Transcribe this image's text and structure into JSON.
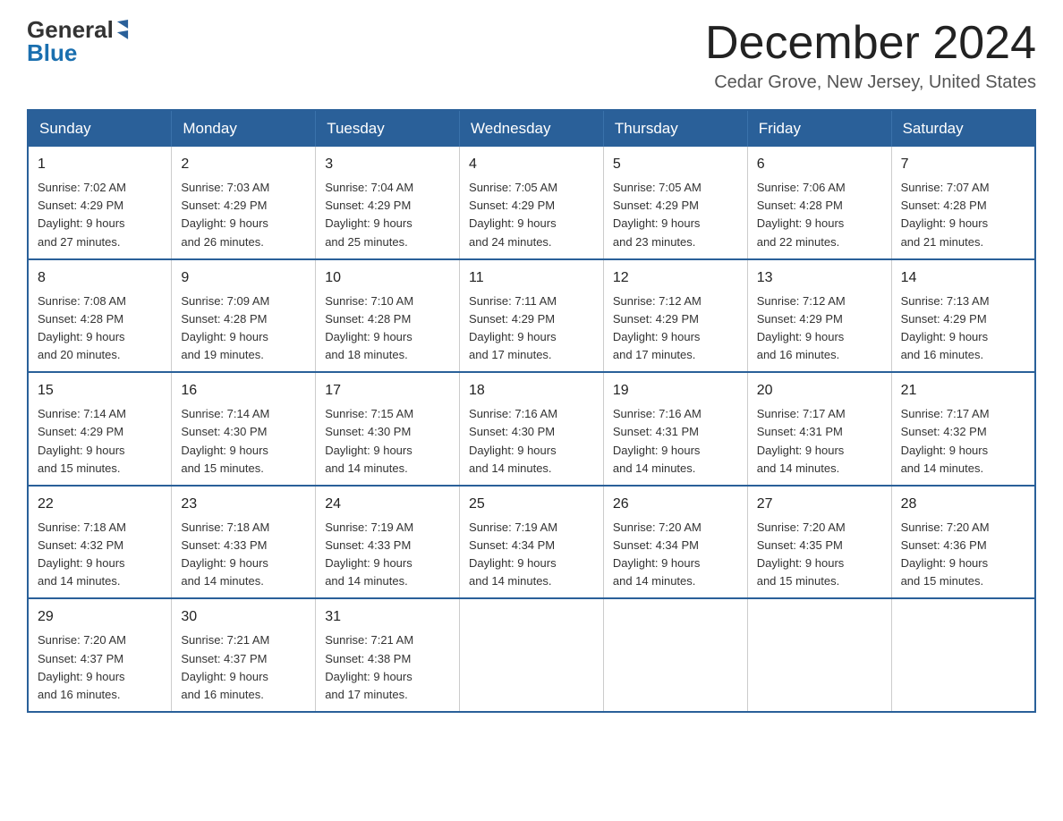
{
  "logo": {
    "general": "General",
    "blue": "Blue"
  },
  "title": {
    "month": "December 2024",
    "location": "Cedar Grove, New Jersey, United States"
  },
  "header": {
    "days": [
      "Sunday",
      "Monday",
      "Tuesday",
      "Wednesday",
      "Thursday",
      "Friday",
      "Saturday"
    ]
  },
  "weeks": [
    [
      {
        "day": "1",
        "sunrise": "7:02 AM",
        "sunset": "4:29 PM",
        "daylight": "9 hours and 27 minutes."
      },
      {
        "day": "2",
        "sunrise": "7:03 AM",
        "sunset": "4:29 PM",
        "daylight": "9 hours and 26 minutes."
      },
      {
        "day": "3",
        "sunrise": "7:04 AM",
        "sunset": "4:29 PM",
        "daylight": "9 hours and 25 minutes."
      },
      {
        "day": "4",
        "sunrise": "7:05 AM",
        "sunset": "4:29 PM",
        "daylight": "9 hours and 24 minutes."
      },
      {
        "day": "5",
        "sunrise": "7:05 AM",
        "sunset": "4:29 PM",
        "daylight": "9 hours and 23 minutes."
      },
      {
        "day": "6",
        "sunrise": "7:06 AM",
        "sunset": "4:28 PM",
        "daylight": "9 hours and 22 minutes."
      },
      {
        "day": "7",
        "sunrise": "7:07 AM",
        "sunset": "4:28 PM",
        "daylight": "9 hours and 21 minutes."
      }
    ],
    [
      {
        "day": "8",
        "sunrise": "7:08 AM",
        "sunset": "4:28 PM",
        "daylight": "9 hours and 20 minutes."
      },
      {
        "day": "9",
        "sunrise": "7:09 AM",
        "sunset": "4:28 PM",
        "daylight": "9 hours and 19 minutes."
      },
      {
        "day": "10",
        "sunrise": "7:10 AM",
        "sunset": "4:28 PM",
        "daylight": "9 hours and 18 minutes."
      },
      {
        "day": "11",
        "sunrise": "7:11 AM",
        "sunset": "4:29 PM",
        "daylight": "9 hours and 17 minutes."
      },
      {
        "day": "12",
        "sunrise": "7:12 AM",
        "sunset": "4:29 PM",
        "daylight": "9 hours and 17 minutes."
      },
      {
        "day": "13",
        "sunrise": "7:12 AM",
        "sunset": "4:29 PM",
        "daylight": "9 hours and 16 minutes."
      },
      {
        "day": "14",
        "sunrise": "7:13 AM",
        "sunset": "4:29 PM",
        "daylight": "9 hours and 16 minutes."
      }
    ],
    [
      {
        "day": "15",
        "sunrise": "7:14 AM",
        "sunset": "4:29 PM",
        "daylight": "9 hours and 15 minutes."
      },
      {
        "day": "16",
        "sunrise": "7:14 AM",
        "sunset": "4:30 PM",
        "daylight": "9 hours and 15 minutes."
      },
      {
        "day": "17",
        "sunrise": "7:15 AM",
        "sunset": "4:30 PM",
        "daylight": "9 hours and 14 minutes."
      },
      {
        "day": "18",
        "sunrise": "7:16 AM",
        "sunset": "4:30 PM",
        "daylight": "9 hours and 14 minutes."
      },
      {
        "day": "19",
        "sunrise": "7:16 AM",
        "sunset": "4:31 PM",
        "daylight": "9 hours and 14 minutes."
      },
      {
        "day": "20",
        "sunrise": "7:17 AM",
        "sunset": "4:31 PM",
        "daylight": "9 hours and 14 minutes."
      },
      {
        "day": "21",
        "sunrise": "7:17 AM",
        "sunset": "4:32 PM",
        "daylight": "9 hours and 14 minutes."
      }
    ],
    [
      {
        "day": "22",
        "sunrise": "7:18 AM",
        "sunset": "4:32 PM",
        "daylight": "9 hours and 14 minutes."
      },
      {
        "day": "23",
        "sunrise": "7:18 AM",
        "sunset": "4:33 PM",
        "daylight": "9 hours and 14 minutes."
      },
      {
        "day": "24",
        "sunrise": "7:19 AM",
        "sunset": "4:33 PM",
        "daylight": "9 hours and 14 minutes."
      },
      {
        "day": "25",
        "sunrise": "7:19 AM",
        "sunset": "4:34 PM",
        "daylight": "9 hours and 14 minutes."
      },
      {
        "day": "26",
        "sunrise": "7:20 AM",
        "sunset": "4:34 PM",
        "daylight": "9 hours and 14 minutes."
      },
      {
        "day": "27",
        "sunrise": "7:20 AM",
        "sunset": "4:35 PM",
        "daylight": "9 hours and 15 minutes."
      },
      {
        "day": "28",
        "sunrise": "7:20 AM",
        "sunset": "4:36 PM",
        "daylight": "9 hours and 15 minutes."
      }
    ],
    [
      {
        "day": "29",
        "sunrise": "7:20 AM",
        "sunset": "4:37 PM",
        "daylight": "9 hours and 16 minutes."
      },
      {
        "day": "30",
        "sunrise": "7:21 AM",
        "sunset": "4:37 PM",
        "daylight": "9 hours and 16 minutes."
      },
      {
        "day": "31",
        "sunrise": "7:21 AM",
        "sunset": "4:38 PM",
        "daylight": "9 hours and 17 minutes."
      },
      null,
      null,
      null,
      null
    ]
  ],
  "labels": {
    "sunrise": "Sunrise:",
    "sunset": "Sunset:",
    "daylight": "Daylight:"
  }
}
